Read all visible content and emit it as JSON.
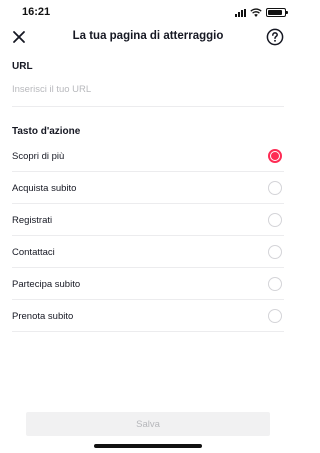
{
  "status_bar": {
    "time": "16:21",
    "battery_level": 0.9
  },
  "nav": {
    "title": "La tua pagina di atterraggio",
    "close_icon": "close-icon",
    "help_icon": "help-circle-icon"
  },
  "url_section": {
    "label": "URL",
    "value": "",
    "placeholder": "Inserisci il tuo URL"
  },
  "action_section": {
    "label": "Tasto d'azione",
    "options": [
      {
        "label": "Scopri di più",
        "selected": true
      },
      {
        "label": "Acquista subito",
        "selected": false
      },
      {
        "label": "Registrati",
        "selected": false
      },
      {
        "label": "Contattaci",
        "selected": false
      },
      {
        "label": "Partecipa subito",
        "selected": false
      },
      {
        "label": "Prenota subito",
        "selected": false
      }
    ]
  },
  "footer": {
    "save_label": "Salva"
  },
  "colors": {
    "accent": "#fe2c55",
    "text": "#161823",
    "placeholder": "#b8b9bd",
    "divider": "#ececee",
    "button_disabled_bg": "#f1f1f2",
    "button_disabled_text": "#b6b7bb"
  }
}
